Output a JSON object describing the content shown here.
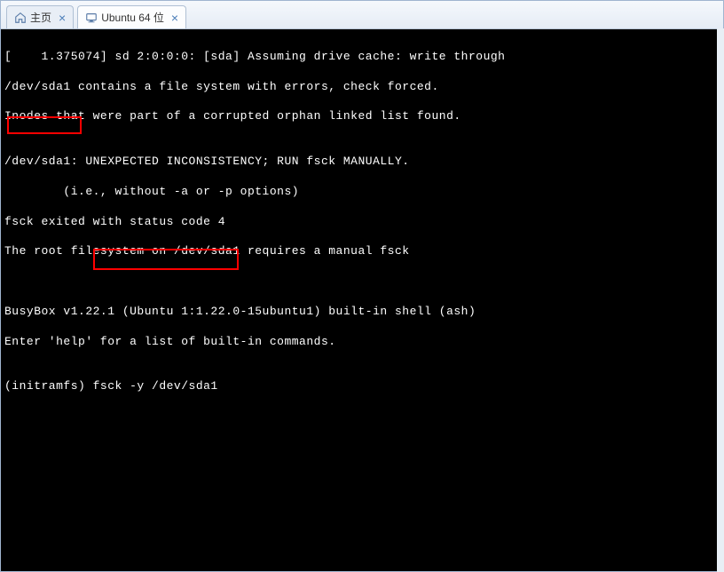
{
  "tabs": [
    {
      "label": "主页",
      "icon": "home-icon",
      "active": false
    },
    {
      "label": "Ubuntu 64 位",
      "icon": "monitor-icon",
      "active": true
    }
  ],
  "terminal": {
    "lines": [
      "[    1.375074] sd 2:0:0:0: [sda] Assuming drive cache: write through",
      "/dev/sda1 contains a file system with errors, check forced.",
      "Inodes that were part of a corrupted orphan linked list found.",
      "",
      "/dev/sda1: UNEXPECTED INCONSISTENCY; RUN fsck MANUALLY.",
      "        (i.e., without -a or -p options)",
      "fsck exited with status code 4",
      "The root filesystem on /dev/sda1 requires a manual fsck",
      "",
      "",
      "BusyBox v1.22.1 (Ubuntu 1:1.22.0-15ubuntu1) built-in shell (ash)",
      "Enter 'help' for a list of built-in commands.",
      "",
      "(initramfs) fsck -y /dev/sda1"
    ],
    "highlighted_device": "/dev/sda1:",
    "highlighted_command": "fsck -y /dev/sda1"
  }
}
